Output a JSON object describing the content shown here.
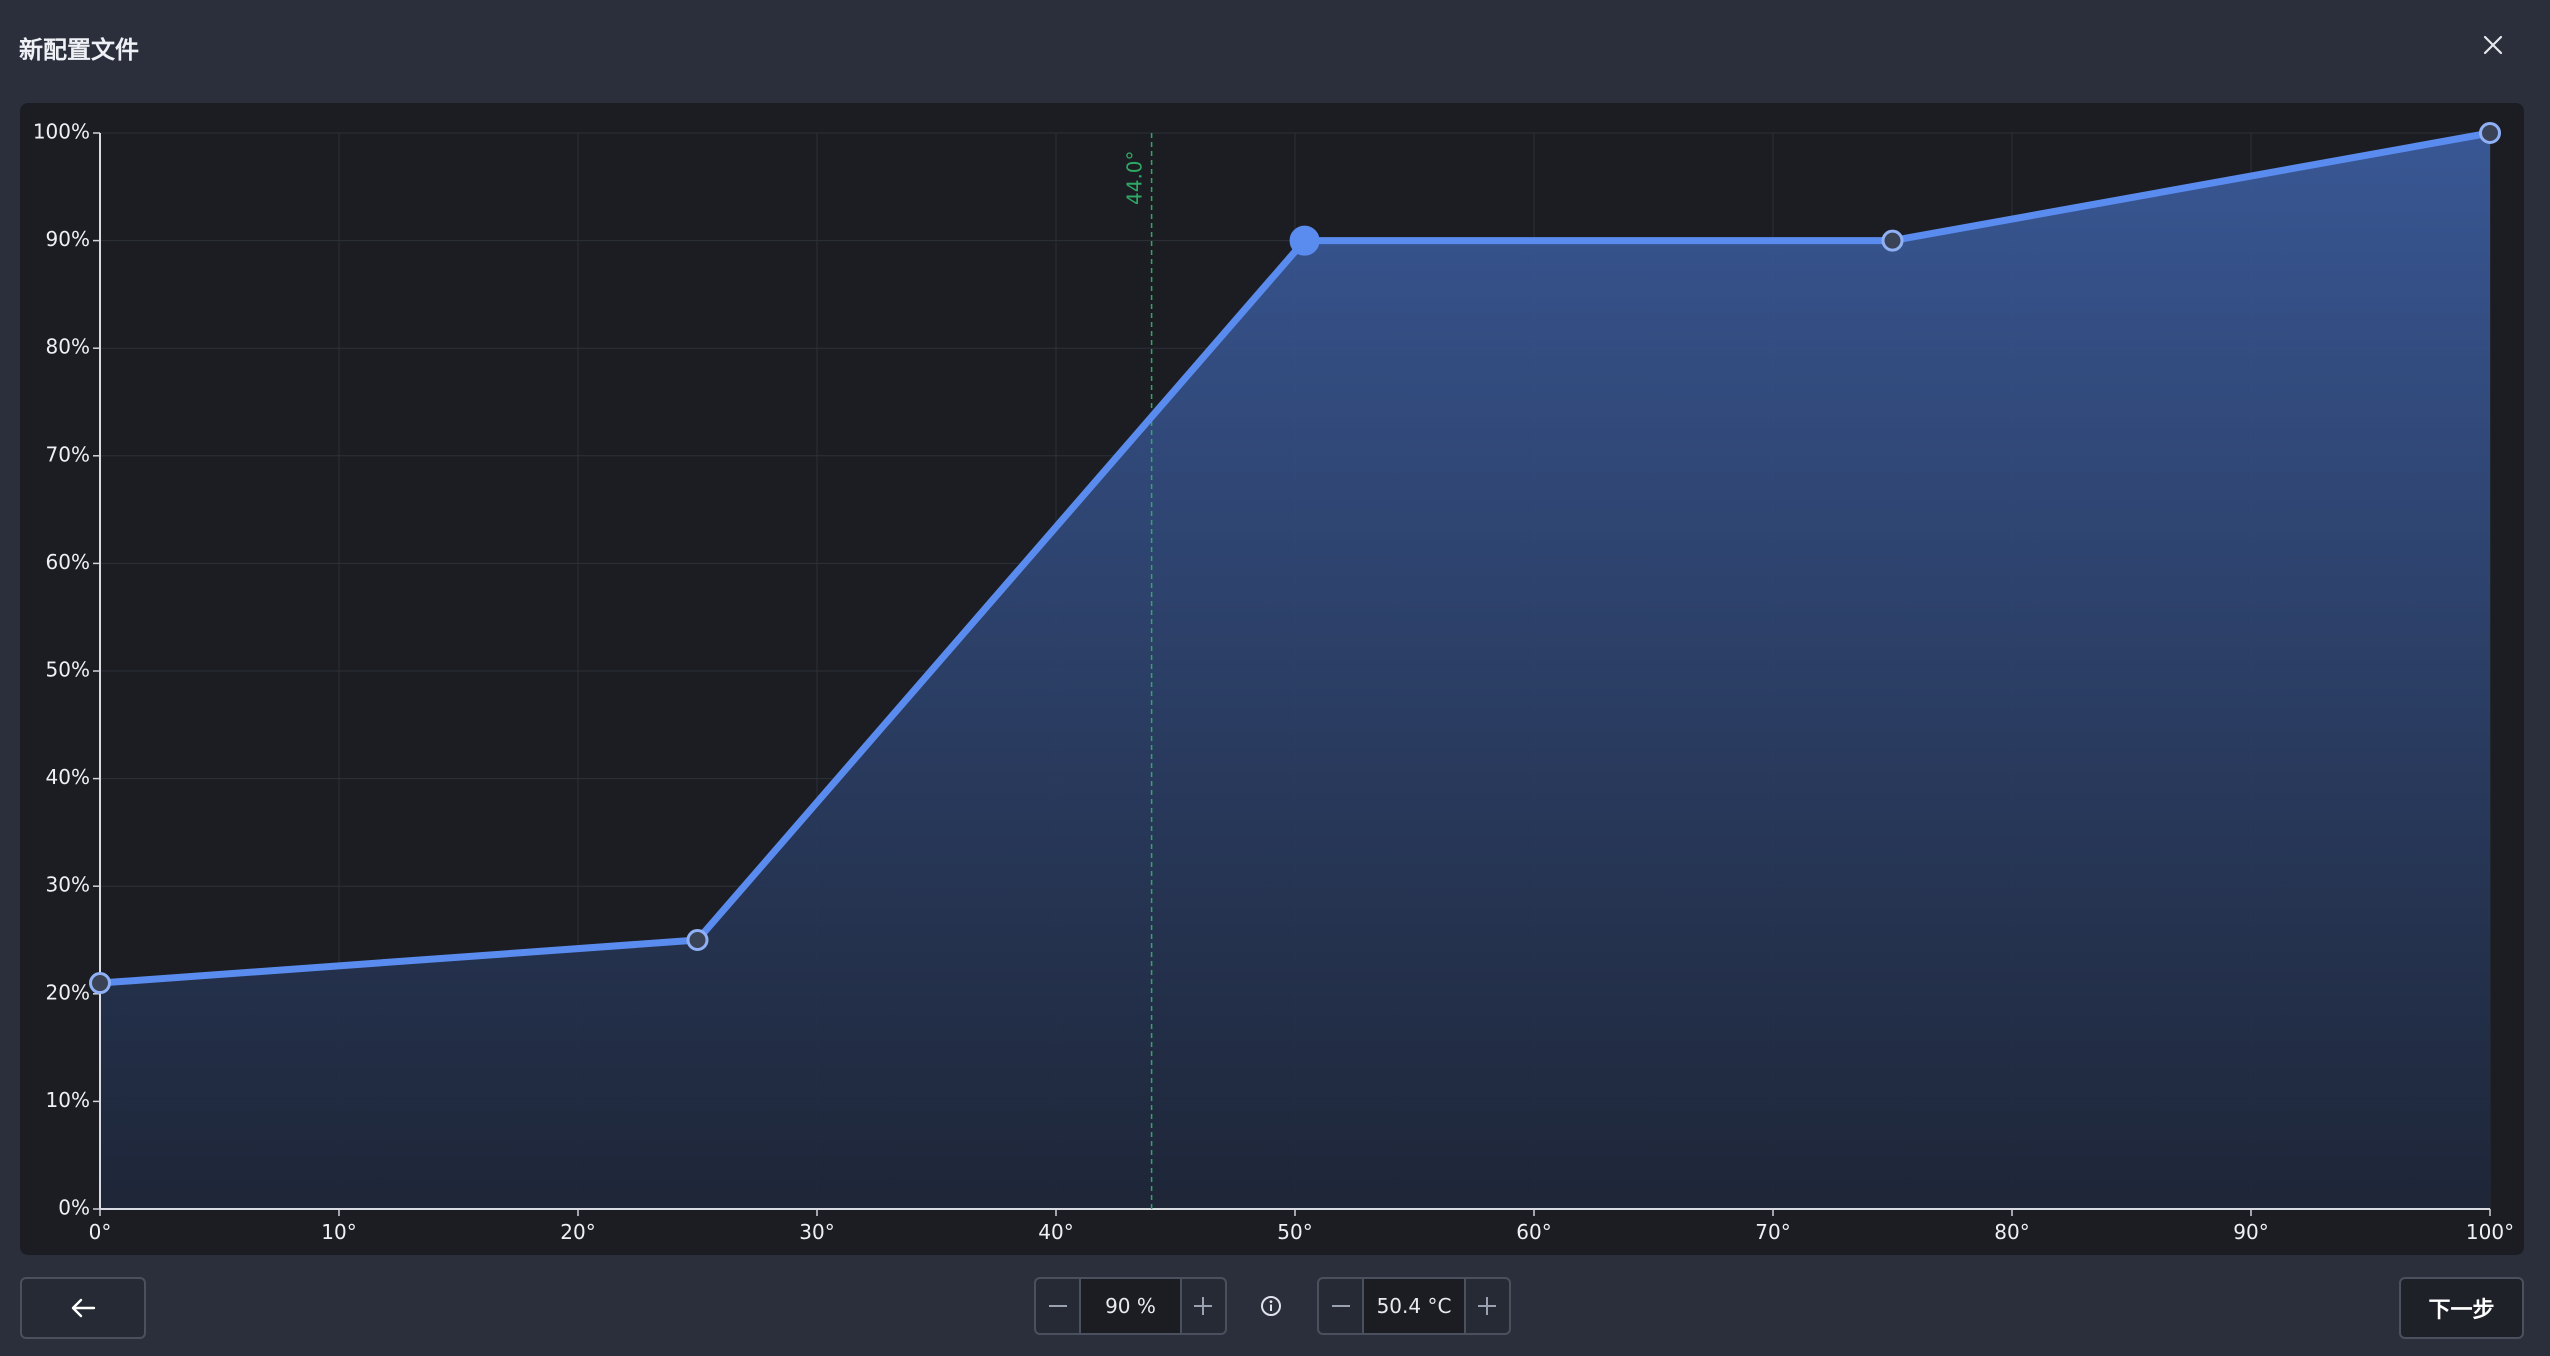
{
  "window": {
    "title": "新配置文件"
  },
  "icons": {
    "close": "close-icon",
    "back": "arrow-left-icon",
    "minus": "minus-icon",
    "plus": "plus-icon",
    "info": "info-icon"
  },
  "colors": {
    "curve": "#5a8cf0",
    "fill_top": "#3a5a9a",
    "marker": "#2fa865",
    "grid": "#2c3038"
  },
  "chart_data": {
    "type": "area",
    "x_ticks": [
      "0°",
      "10°",
      "20°",
      "30°",
      "40°",
      "50°",
      "60°",
      "70°",
      "80°",
      "90°",
      "100°"
    ],
    "y_ticks": [
      "0%",
      "10%",
      "20%",
      "30%",
      "40%",
      "50%",
      "60%",
      "70%",
      "80%",
      "90%",
      "100%"
    ],
    "xlim": [
      0,
      100
    ],
    "ylim": [
      0,
      100
    ],
    "grid": true,
    "points": [
      {
        "x": 0,
        "y": 21
      },
      {
        "x": 25,
        "y": 25
      },
      {
        "x": 50.4,
        "y": 90
      },
      {
        "x": 75,
        "y": 90
      },
      {
        "x": 100,
        "y": 100
      }
    ],
    "selected_index": 2,
    "marker": {
      "x": 44.0,
      "label": "44.0°"
    }
  },
  "controls": {
    "duty": {
      "value": "90 %"
    },
    "temperature": {
      "value": "50.4 °C"
    },
    "next_label": "下一步"
  }
}
